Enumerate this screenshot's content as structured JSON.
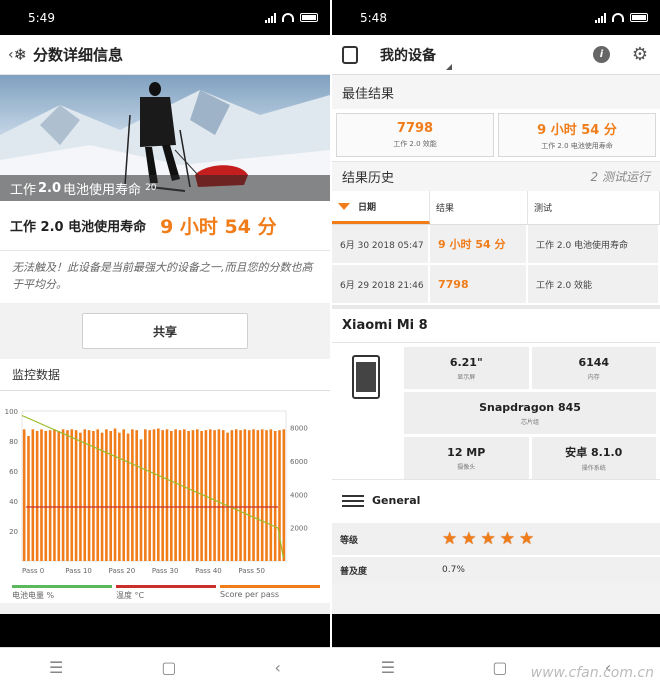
{
  "left": {
    "status_time": "5:49",
    "header_title": "分数详细信息",
    "hero_caption_prefix": "工作",
    "hero_caption_version": "2.0",
    "hero_caption_suffix": "电池使用寿命",
    "hero_caption_small": "20",
    "score_label": "工作 2.0 电池使用寿命",
    "score_value": "9 小时 54 分",
    "description": "无法触及！此设备是当前最强大的设备之一,而且您的分数也高于平均分。",
    "share_label": "共享",
    "monitor_title": "监控数据",
    "legend": [
      {
        "label": "电池电量 %",
        "color": "#5cb85c"
      },
      {
        "label": "温度 °C",
        "color": "#c9302c"
      },
      {
        "label": "Score per pass",
        "color": "#f07d1a"
      }
    ]
  },
  "chart_data": {
    "type": "bar",
    "x_ticks": [
      "Pass 0",
      "Pass 10",
      "Pass 20",
      "Pass 30",
      "Pass 40",
      "Pass 50"
    ],
    "left_axis_ticks": [
      "100",
      "80",
      "60",
      "40",
      "20"
    ],
    "right_axis_ticks": [
      "8000",
      "6000",
      "4000",
      "2000"
    ],
    "ylim_left": [
      0,
      100
    ],
    "ylim_right": [
      0,
      9000
    ],
    "passes": 61,
    "series": [
      {
        "name": "Score per pass",
        "color": "#f07d1a",
        "axis": "right",
        "values": [
          7900,
          7500,
          7900,
          7800,
          7900,
          7800,
          7850,
          7900,
          7800,
          7900,
          7850,
          7900,
          7850,
          7700,
          7900,
          7850,
          7800,
          7900,
          7700,
          7900,
          7800,
          7950,
          7700,
          7900,
          7650,
          7900,
          7850,
          7300,
          7900,
          7850,
          7900,
          7950,
          7850,
          7900,
          7800,
          7900,
          7850,
          7900,
          7800,
          7850,
          7900,
          7800,
          7850,
          7900,
          7850,
          7900,
          7850,
          7700,
          7850,
          7900,
          7850,
          7900,
          7850,
          7900,
          7850,
          7900,
          7850,
          7900,
          7800,
          7850,
          7900
        ]
      },
      {
        "name": "电池电量 %",
        "color": "#9bbb2a",
        "axis": "left",
        "start": 97,
        "end": 2
      },
      {
        "name": "温度 °C",
        "color": "#c9302c",
        "axis": "left",
        "value": 36
      }
    ]
  },
  "right": {
    "status_time": "5:48",
    "header_title": "我的设备",
    "info_label": "i",
    "best_title": "最佳结果",
    "best": [
      {
        "value": "7798",
        "label": "工作 2.0 效能"
      },
      {
        "value": "9 小时 54 分",
        "label": "工作 2.0 电池使用寿命"
      }
    ],
    "history_title": "结果历史",
    "history_runs": "2 测试运行",
    "table_headers": [
      "日期",
      "结果",
      "测试"
    ],
    "table_rows": [
      {
        "date": "6月 30 2018 05:47",
        "result": "9 小时 54 分",
        "test": "工作 2.0 电池使用寿命"
      },
      {
        "date": "6月 29 2018 21:46",
        "result": "7798",
        "test": "工作 2.0 效能"
      }
    ],
    "device_name": "Xiaomi Mi 8",
    "specs": {
      "screen": {
        "value": "6.21\"",
        "label": "显示屏"
      },
      "memory": {
        "value": "6144",
        "label": "内存"
      },
      "chip": {
        "value": "Snapdragon 845",
        "label": "芯片组"
      },
      "camera": {
        "value": "12 MP",
        "label": "摄像头"
      },
      "os": {
        "value": "安卓 8.1.0",
        "label": "操作系统"
      }
    },
    "general_label": "General",
    "rating_label": "等级",
    "rating_stars": 5,
    "popularity_label": "普及度",
    "popularity_value": "0.7%"
  },
  "watermark": "www.cfan.com.cn"
}
